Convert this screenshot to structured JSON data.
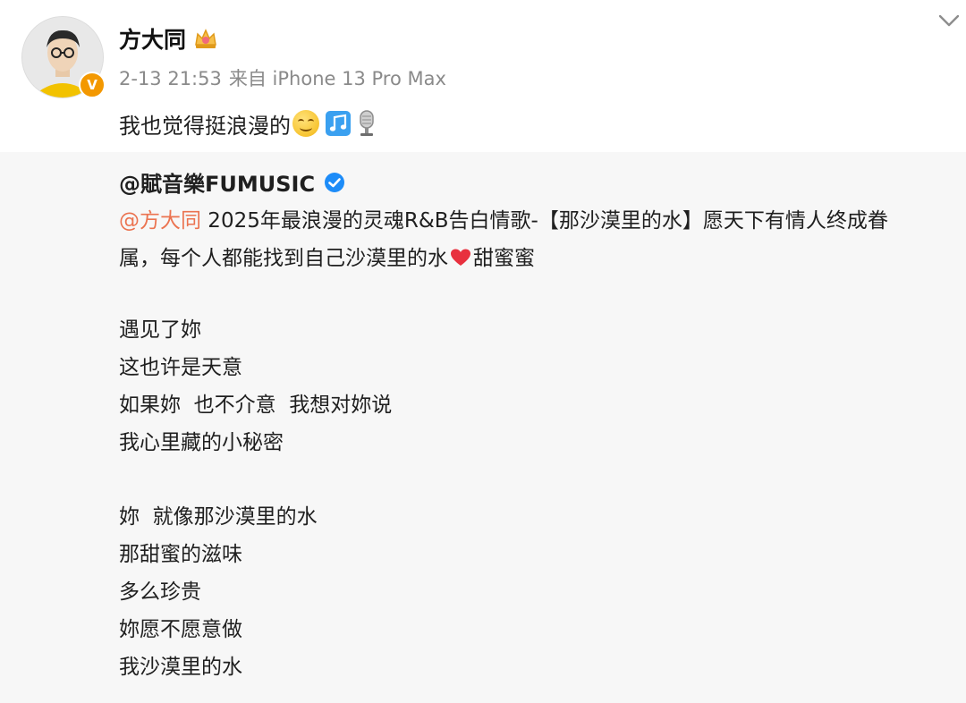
{
  "post": {
    "author": "方大同",
    "timestamp": "2-13 21:53",
    "source_prefix": "来自",
    "source_device": "iPhone 13 Pro Max",
    "text": "我也觉得挺浪漫的",
    "emojis": [
      "smile-emoji",
      "music-note-emoji",
      "microphone-emoji"
    ]
  },
  "repost": {
    "author": "@賦音樂FUMUSIC",
    "mention": "@方大同",
    "line1": " 2025年最浪漫的灵魂R&B告白情歌-【那沙漠里的水】愿天下有情人终成眷",
    "line2_a": "属，每个人都能找到自己沙漠里的水",
    "line2_b": "甜蜜蜜",
    "stanza1": [
      "遇见了妳",
      "这也许是天意",
      "如果妳  也不介意  我想对妳说",
      "我心里藏的小秘密"
    ],
    "stanza2": [
      "妳  就像那沙漠里的水",
      "那甜蜜的滋味",
      "多么珍贵",
      "妳愿不愿意做",
      "我沙漠里的水"
    ]
  },
  "colors": {
    "mention": "#eb7350",
    "verified_orange": "#f39800",
    "verified_blue": "#1d8cf8",
    "repost_bg": "#f7f7f7",
    "meta_gray": "#8a8a8a"
  }
}
